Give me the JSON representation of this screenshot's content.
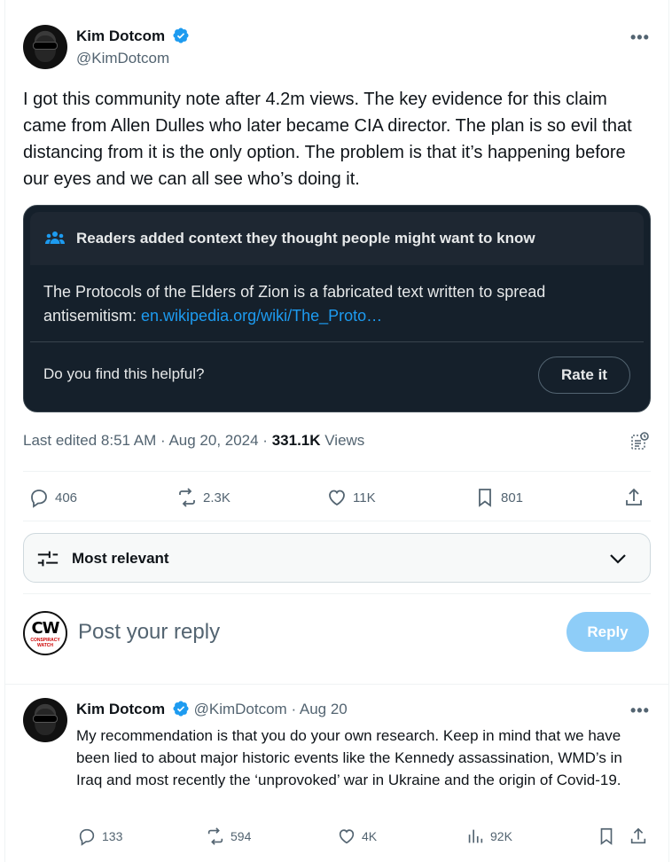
{
  "tweet": {
    "author_name": "Kim Dotcom",
    "author_handle": "@KimDotcom",
    "text": "I got this community note after 4.2m views. The key evidence for this claim came from Allen Dulles who later became CIA director. The plan is so evil that distancing from it is the only option. The problem is that it’s happening before our eyes and we can all see who’s doing it.",
    "more_label": "•••",
    "meta_prefix": "Last edited 8:51 AM · Aug 20, 2024 · ",
    "views_count": "331.1K",
    "views_label": " Views"
  },
  "community_note": {
    "header": "Readers added context they thought people might want to know",
    "body": "The Protocols of the Elders of Zion is a fabricated text written to spread antisemitism: ",
    "link": "en.wikipedia.org/wiki/The_Proto…",
    "question": "Do you find this helpful?",
    "rate_label": "Rate it",
    "background": "#15202b"
  },
  "actions": {
    "replies": "406",
    "reposts": "2.3K",
    "likes": "11K",
    "bookmarks": "801"
  },
  "sort": {
    "label": "Most relevant"
  },
  "composer": {
    "placeholder": "Post your reply",
    "button_label": "Reply",
    "avatar_text": "CW",
    "avatar_subtext": "CONSPIRACY WATCH"
  },
  "reply": {
    "author_name": "Kim Dotcom",
    "author_handle": "@KimDotcom",
    "date": "· Aug 20",
    "text": "My recommendation is that you do your own research. Keep in mind that we have been lied to about major historic events like the Kennedy assassination, WMD’s in Iraq and most recently the ‘unprovoked’ war in Ukraine and the origin of Covid-19.",
    "more_label": "•••",
    "replies": "133",
    "reposts": "594",
    "likes": "4K",
    "views": "92K"
  },
  "colors": {
    "accent": "#1d9bf0",
    "muted": "#536471",
    "reply_button": "#8ecdf8"
  }
}
